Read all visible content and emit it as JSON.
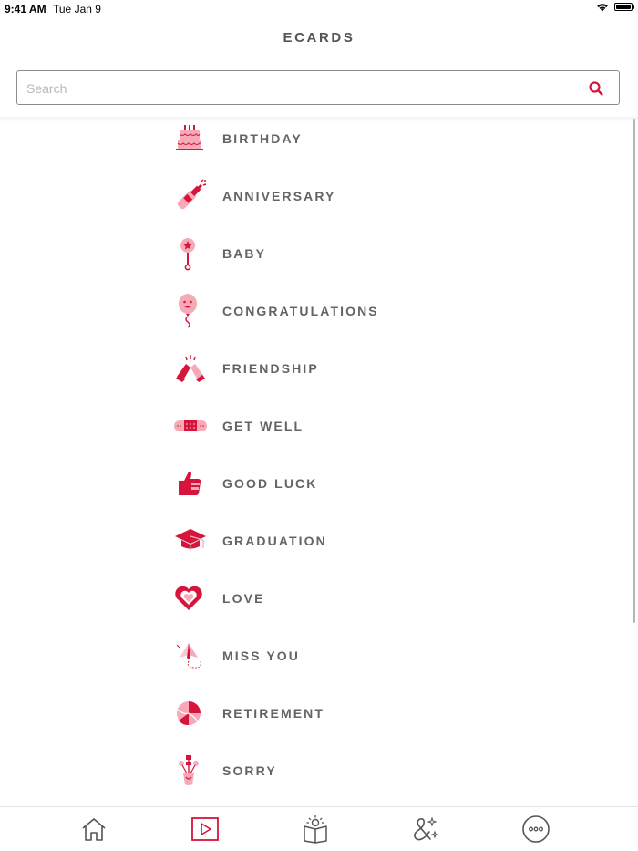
{
  "status_bar": {
    "time": "9:41 AM",
    "date": "Tue Jan 9"
  },
  "header": {
    "title": "ECARDS"
  },
  "search": {
    "placeholder": "Search",
    "value": ""
  },
  "categories": [
    {
      "label": "BIRTHDAY",
      "icon": "birthday-cake-icon"
    },
    {
      "label": "ANNIVERSARY",
      "icon": "champagne-bottle-icon"
    },
    {
      "label": "BABY",
      "icon": "baby-rattle-icon"
    },
    {
      "label": "CONGRATULATIONS",
      "icon": "smiley-balloon-icon"
    },
    {
      "label": "FRIENDSHIP",
      "icon": "high-five-icon"
    },
    {
      "label": "GET WELL",
      "icon": "bandage-icon"
    },
    {
      "label": "GOOD LUCK",
      "icon": "thumbs-up-icon"
    },
    {
      "label": "GRADUATION",
      "icon": "graduation-cap-icon"
    },
    {
      "label": "LOVE",
      "icon": "heart-icon"
    },
    {
      "label": "MISS YOU",
      "icon": "paper-airplane-icon"
    },
    {
      "label": "RETIREMENT",
      "icon": "beach-ball-icon"
    },
    {
      "label": "SORRY",
      "icon": "flower-vase-icon"
    }
  ],
  "tab_bar": {
    "tabs": [
      {
        "name": "home",
        "icon": "home-icon"
      },
      {
        "name": "ecards",
        "icon": "play-card-icon",
        "active": true
      },
      {
        "name": "stories",
        "icon": "book-icon"
      },
      {
        "name": "ampersand",
        "icon": "ampersand-icon"
      },
      {
        "name": "more",
        "icon": "more-icon"
      }
    ]
  },
  "colors": {
    "accent": "#d7143c",
    "accent_light": "#f6a9b6",
    "text": "#646464",
    "tab_icon": "#555555"
  }
}
